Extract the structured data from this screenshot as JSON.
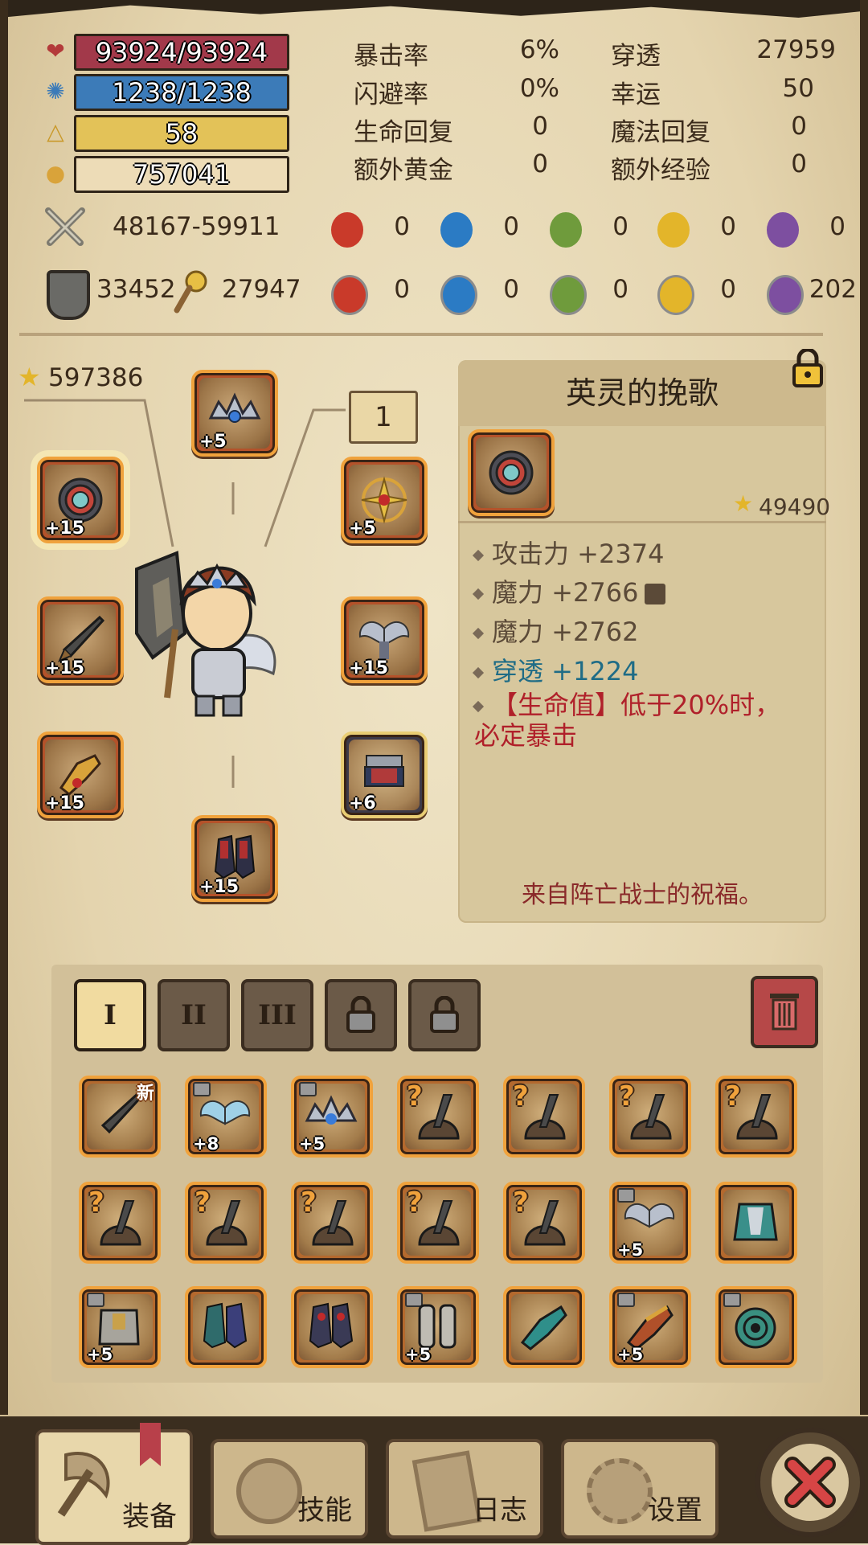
{
  "resources": {
    "hp": "93924/93924",
    "mp": "1238/1238",
    "level": "58",
    "gold": "757041"
  },
  "stats": {
    "crit_rate": {
      "label": "暴击率",
      "value": "6%"
    },
    "dodge_rate": {
      "label": "闪避率",
      "value": "0%"
    },
    "hp_regen": {
      "label": "生命回复",
      "value": "0"
    },
    "bonus_gold": {
      "label": "额外黄金",
      "value": "0"
    },
    "penetration": {
      "label": "穿透",
      "value": "27959"
    },
    "luck": {
      "label": "幸运",
      "value": "50"
    },
    "mp_regen": {
      "label": "魔法回复",
      "value": "0"
    },
    "bonus_exp": {
      "label": "额外经验",
      "value": "0"
    }
  },
  "attack": {
    "range": "48167-59911",
    "elements": [
      "0",
      "0",
      "0",
      "0",
      "0"
    ]
  },
  "defense": {
    "armor": "33452",
    "magic": "27947",
    "resists": [
      "0",
      "0",
      "0",
      "0",
      "202"
    ]
  },
  "colors": {
    "fire": "#c93a2a",
    "water": "#2b7bc4",
    "nature": "#6f9b3c",
    "light": "#e3b52a",
    "dark": "#7d4fa0"
  },
  "gear_score": "597386",
  "set_badge": "1",
  "equipment": {
    "crown": "+5",
    "ring": "+15",
    "amulet": "+5",
    "weapon": "+15",
    "wings": "+15",
    "gloves": "+15",
    "armor": "+6",
    "boots": "+15"
  },
  "detail": {
    "name": "英灵的挽歌",
    "score": "49490",
    "lines": [
      {
        "text": "攻击力 +2374"
      },
      {
        "text": "魔力 +2766"
      },
      {
        "text": "魔力 +2762"
      },
      {
        "text": "穿透 +1224"
      },
      {
        "text": "【生命值】低于20%时，必定暴击"
      }
    ],
    "flavor": "来自阵亡战士的祝福。"
  },
  "bag": {
    "tabs": [
      "I",
      "II",
      "III"
    ],
    "new_label": "新",
    "row1": [
      "",
      "+8",
      "+5",
      "",
      "",
      "",
      ""
    ],
    "row2": [
      "",
      "",
      "",
      "",
      "",
      "+5",
      ""
    ],
    "row3": [
      "+5",
      "",
      "",
      "+5",
      "",
      "+5",
      ""
    ]
  },
  "nav": {
    "equip": "装备",
    "skills": "技能",
    "log": "日志",
    "settings": "设置"
  }
}
